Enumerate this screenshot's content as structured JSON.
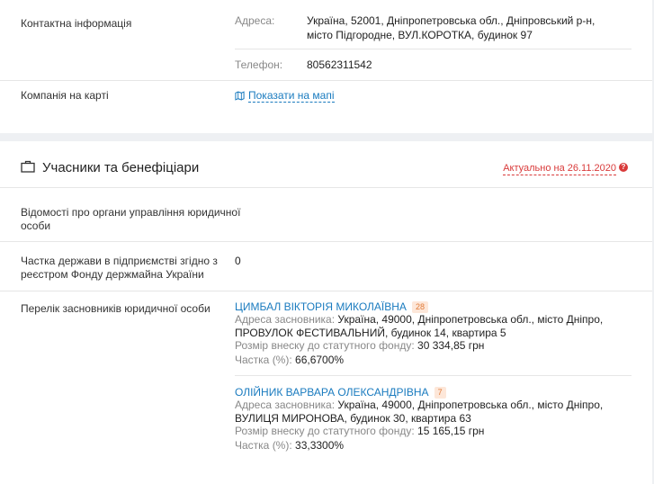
{
  "contact": {
    "label": "Контактна інформація",
    "address_label": "Адреса:",
    "address_line1": "Україна, 52001, Дніпропетровська обл., Дніпровський р-н,",
    "address_line2": "місто Підгородне, ВУЛ.КОРОТКА, будинок 97",
    "phone_label": "Телефон:",
    "phone_value": "80562311542"
  },
  "map": {
    "label": "Компанія на карті",
    "link": "Показати на мапі",
    "icon": "map-icon"
  },
  "participants": {
    "title": "Учасники та бенефіціари",
    "icon": "briefcase-icon",
    "actual": "Актуально на 26.11.2020",
    "help_icon": "?",
    "rows": {
      "governance_label_1": "Відомості про органи управління юридичної",
      "governance_label_2": "особи",
      "state_share_label_1": "Частка держави в підприємстві згідно з",
      "state_share_label_2": "реєстром Фонду держмайна України",
      "state_share_value": "0",
      "founders_label": "Перелік засновників юридичної особи"
    },
    "founders": [
      {
        "name": "ЦИМБАЛ ВІКТОРІЯ МИКОЛАЇВНА",
        "badge": "28",
        "address_key": "Адреса засновника:",
        "address_1": "Україна, 49000, Дніпропетровська обл., місто Дніпро, ПРОВУЛОК",
        "address_2": "ФЕСТИВАЛЬНИЙ, будинок 14, квартира 5",
        "contribution_key": "Розмір внеску до статутного фонду:",
        "contribution": "30 334,85 грн",
        "share_key": "Частка (%):",
        "share": "66,6700%"
      },
      {
        "name": "ОЛІЙНИК ВАРВАРА ОЛЕКСАНДРІВНА",
        "badge": "7",
        "address_key": "Адреса засновника:",
        "address_1": "Україна, 49000, Дніпропетровська обл., місто Дніпро, ВУЛИЦЯ",
        "address_2": "МИРОНОВА, будинок 30, квартира 63",
        "contribution_key": "Розмір внеску до статутного фонду:",
        "contribution": "15 165,15 грн",
        "share_key": "Частка (%):",
        "share": "33,3300%"
      }
    ]
  }
}
